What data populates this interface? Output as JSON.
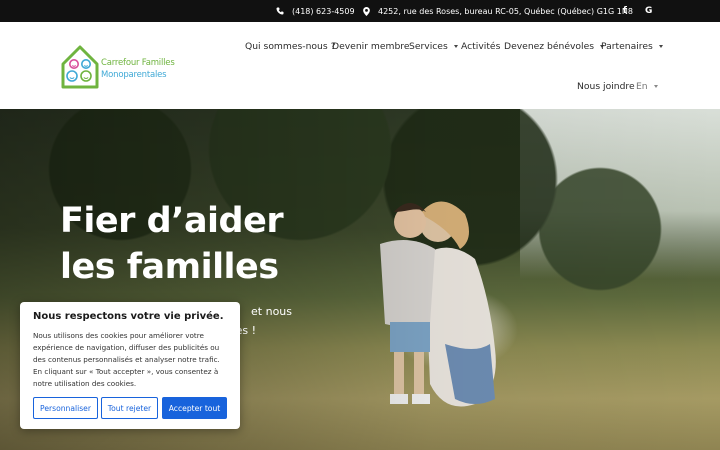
{
  "topbar": {
    "phone": "(418) 623-4509",
    "address": "4252, rue des Roses, bureau RC-05, Québec (Québec) G1G 1N8",
    "icons": [
      "phone-icon",
      "map-pin-icon",
      "facebook-icon",
      "google-icon"
    ],
    "facebook_glyph": "f",
    "google_glyph": "G"
  },
  "logo": {
    "line1": "Carrefour Familles",
    "line2": "Monoparentales"
  },
  "nav": {
    "items": [
      {
        "label": "Qui sommes-nous ?"
      },
      {
        "label": "Devenir membre"
      },
      {
        "label": "Services"
      },
      {
        "label": "Activités"
      },
      {
        "label": "Devenez bénévoles"
      },
      {
        "label": "Partenaires"
      },
      {
        "label": "Nous joindre"
      },
      {
        "label": "En"
      }
    ]
  },
  "hero": {
    "title_line1": "Fier d’aider",
    "title_line2": "les familles",
    "subtitle_line1": "et nous",
    "subtitle_line2": "es !"
  },
  "cookie": {
    "title": "Nous respectons votre vie privée.",
    "text": "Nous utilisons des cookies pour améliorer votre expérience de navigation, diffuser des publicités ou des contenus personnalisés et analyser notre trafic. En cliquant sur « Tout accepter », vous consentez à notre utilisation des cookies.",
    "customize_label": "Personnaliser",
    "reject_label": "Tout rejeter",
    "accept_label": "Accepter tout"
  },
  "colors": {
    "topbar_bg": "#111111",
    "logo_green": "#6fb43f",
    "logo_blue": "#3fa9d6",
    "cookie_button_blue": "#1863dc"
  }
}
